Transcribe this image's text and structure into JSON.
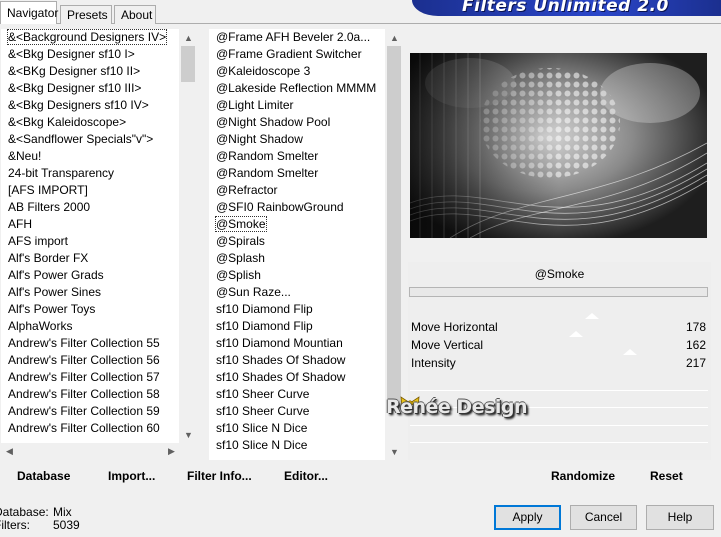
{
  "banner": {
    "title": "Filters Unlimited 2.0"
  },
  "tabs": [
    {
      "label": "Navigator",
      "active": true
    },
    {
      "label": "Presets",
      "active": false
    },
    {
      "label": "About",
      "active": false
    }
  ],
  "categories": [
    "&<Background Designers IV>",
    "&<Bkg Designer sf10 I>",
    "&<BKg Designer sf10 II>",
    "&<Bkg Designer sf10 III>",
    "&<Bkg Designers sf10 IV>",
    "&<Bkg Kaleidoscope>",
    "&<Sandflower Specials\"v\">",
    "&Neu!",
    "24-bit Transparency",
    "[AFS IMPORT]",
    "AB Filters 2000",
    "AFH",
    "AFS import",
    "Alf's Border FX",
    "Alf's Power Grads",
    "Alf's Power Sines",
    "Alf's Power Toys",
    "AlphaWorks",
    "Andrew's Filter Collection 55",
    "Andrew's Filter Collection 56",
    "Andrew's Filter Collection 57",
    "Andrew's Filter Collection 58",
    "Andrew's Filter Collection 59",
    "Andrew's Filter Collection 60"
  ],
  "filters": [
    "@Frame AFH Beveler 2.0a...",
    "@Frame Gradient Switcher",
    "@Kaleidoscope 3",
    "@Lakeside Reflection MMMM",
    "@Light Limiter",
    "@Night Shadow Pool",
    "@Night Shadow",
    "@Random Smelter",
    "@Random Smelter",
    "@Refractor",
    "@SFI0 RainbowGround",
    "@Smoke",
    "@Spirals",
    "@Splash",
    "@Splish",
    "@Sun Raze...",
    "sf10 Diamond Flip",
    "sf10 Diamond Flip",
    "sf10 Diamond Mountian",
    "sf10 Shades Of Shadow",
    "sf10 Shades Of Shadow",
    "sf10 Sheer Curve",
    "sf10 Sheer Curve",
    "sf10 Slice N Dice",
    "sf10 Slice N Dice"
  ],
  "buttons_left": {
    "database": "Database",
    "import": "Import...",
    "filter_info": "Filter Info...",
    "editor": "Editor..."
  },
  "selected_filter": "@Smoke",
  "params": [
    {
      "name": "Move Horizontal",
      "value": "178",
      "level": 178
    },
    {
      "name": "Move Vertical",
      "value": "162",
      "level": 162
    },
    {
      "name": "Intensity",
      "value": "217",
      "level": 217
    }
  ],
  "param_max": 255,
  "watermark": "Renée Design",
  "right_buttons": {
    "randomize": "Randomize",
    "reset": "Reset"
  },
  "status": {
    "database_label": "Database:",
    "database_value": "Mix",
    "filters_label": "Filters:",
    "filters_value": "5039"
  },
  "dialog_buttons": {
    "apply": "Apply",
    "cancel": "Cancel",
    "help": "Help"
  },
  "colors": {
    "banner": "#2a46c9",
    "default_button_border": "#0078d7"
  }
}
